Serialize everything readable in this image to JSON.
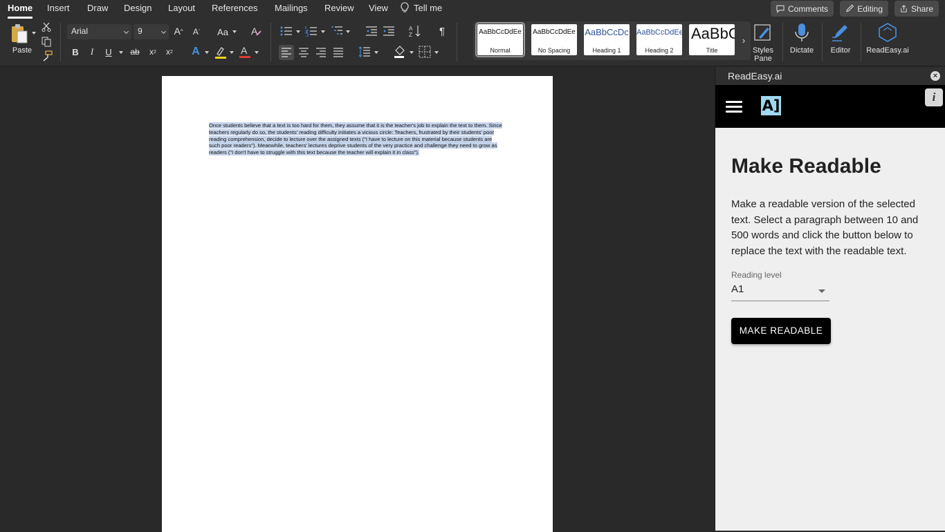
{
  "menu": {
    "tabs": [
      "Home",
      "Insert",
      "Draw",
      "Design",
      "Layout",
      "References",
      "Mailings",
      "Review",
      "View"
    ],
    "tell_me": "Tell me",
    "comments": "Comments",
    "editing": "Editing",
    "share": "Share"
  },
  "ribbon": {
    "paste": "Paste",
    "font_name": "Arial",
    "font_size": "9",
    "change_case": "Aa",
    "bold": "B",
    "italic": "I",
    "underline": "U",
    "strikethrough": "ab",
    "subscript": "x",
    "superscript": "x",
    "styles": [
      {
        "sample": "AaBbCcDdEe",
        "name": "Normal"
      },
      {
        "sample": "AaBbCcDdEe",
        "name": "No Spacing"
      },
      {
        "sample": "AaBbCcDc",
        "name": "Heading 1"
      },
      {
        "sample": "AaBbCcDdEe",
        "name": "Heading 2"
      },
      {
        "sample": "AaBbC",
        "name": "Title"
      }
    ],
    "styles_pane": "Styles Pane",
    "dictate": "Dictate",
    "editor": "Editor",
    "readeasy": "ReadEasy.ai"
  },
  "document": {
    "paragraph": "Once students believe that a text is too hard for them, they assume that it is the teacher's job to explain the text to them. Since teachers regularly do so, the students' reading difficulty initiates a vicious circle: Teachers, frustrated by their students' poor reading comprehension, decide to lecture over the assigned texts (\"I have to lecture on this material because students are such poor readers\"). Meanwhile, teachers' lectures deprive students of the very practice and challenge they need to grow as readers (\"I don't have to struggle with this text because the teacher will explain it in class\")."
  },
  "panel": {
    "title": "ReadEasy.ai",
    "close": "×",
    "logo": "A]",
    "info": "i",
    "heading": "Make Readable",
    "description": "Make a readable version of the selected text. Select a paragraph between 10 and 500 words and click the button below to replace the text with the readable text.",
    "level_label": "Reading level",
    "level_value": "A1",
    "button": "MAKE READABLE"
  },
  "colors": {
    "selection_highlight": "#c5d3ea",
    "logo_bg": "#9fd8ef",
    "accent_blue": "#4a8fe0"
  }
}
